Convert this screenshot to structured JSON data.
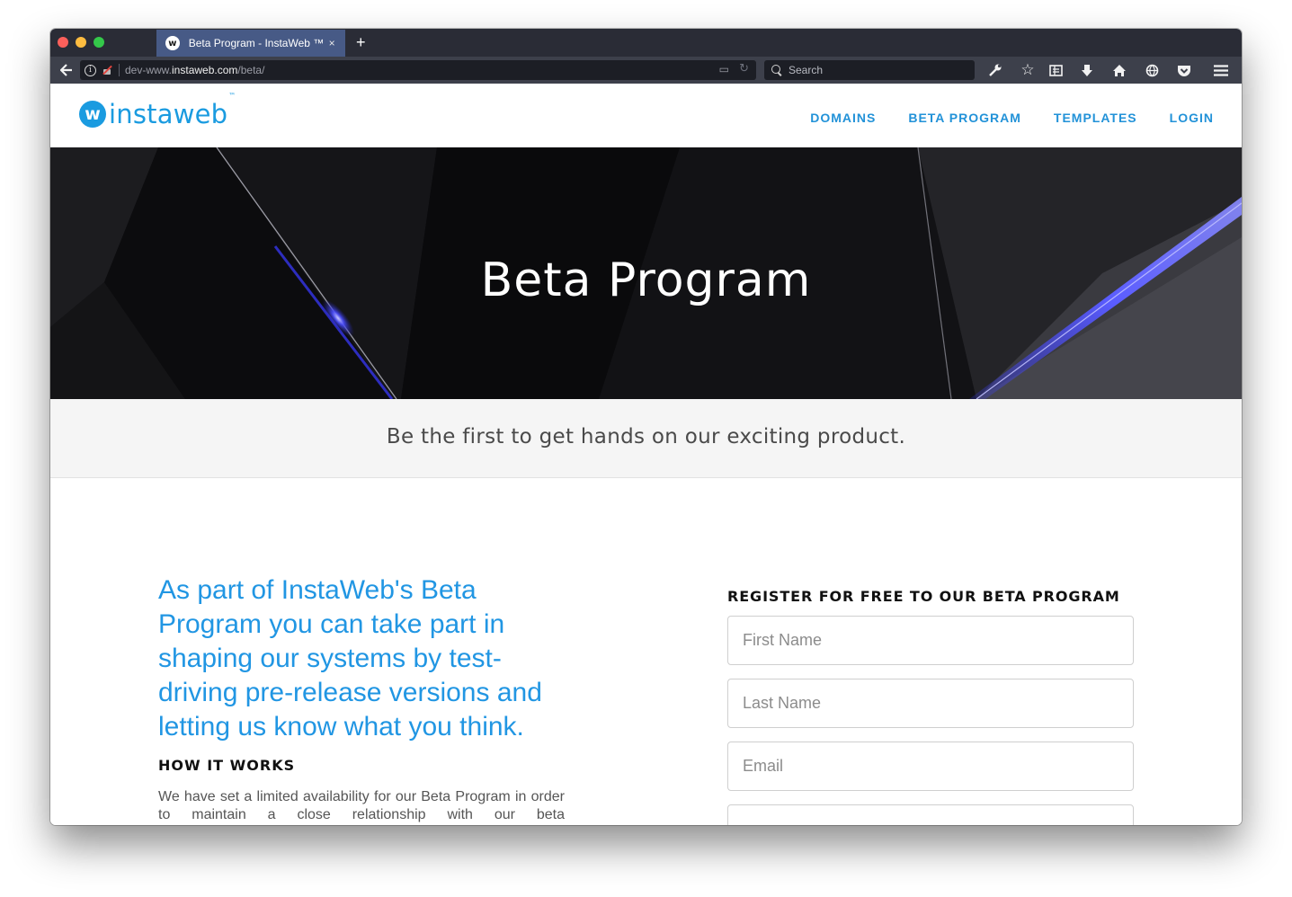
{
  "browser": {
    "tab": {
      "favicon": "w",
      "title": "Beta Program - InstaWeb ™",
      "close_symbol": "×"
    },
    "new_tab_symbol": "+",
    "address": {
      "prefix": "dev-www.",
      "host": "instaweb.com",
      "path": "/beta/"
    },
    "search_placeholder": "Search",
    "toolbar_icons": [
      "back-arrow-icon",
      "info-icon",
      "insecure-lock-icon",
      "reader-view-icon",
      "reload-icon",
      "search-icon",
      "wrench-icon",
      "star-icon",
      "library-icon",
      "download-icon",
      "home-icon",
      "globe-icon",
      "pocket-icon",
      "hamburger-menu-icon"
    ]
  },
  "site": {
    "logo": {
      "mark": "w",
      "text_plain": "insta",
      "text_accent": "web",
      "tm": "™"
    },
    "nav": [
      {
        "label": "DOMAINS"
      },
      {
        "label": "BETA PROGRAM"
      },
      {
        "label": "TEMPLATES"
      },
      {
        "label": "LOGIN"
      }
    ],
    "hero_title": "Beta Program",
    "tagline": "Be the first to get hands on our exciting product.",
    "intro": "As part of InstaWeb's Beta Program you can take part in shaping our systems by test-driving pre-release versions and letting us know what you think.",
    "how_heading": "HOW IT WORKS",
    "how_body": "We have set a limited availability for our Beta Program in order to maintain a close relationship with our beta",
    "register_heading": "REGISTER FOR FREE TO OUR BETA PROGRAM",
    "form": {
      "first_name_placeholder": "First Name",
      "last_name_placeholder": "Last Name",
      "email_placeholder": "Email",
      "fourth_placeholder": ""
    }
  },
  "colors": {
    "brand_blue": "#1a9be0",
    "nav_blue": "#2292d8",
    "intro_blue": "#2196e3",
    "chrome_dark": "#2a2c36",
    "active_tab": "#475a86",
    "hero_glow": "#4a4cff"
  }
}
